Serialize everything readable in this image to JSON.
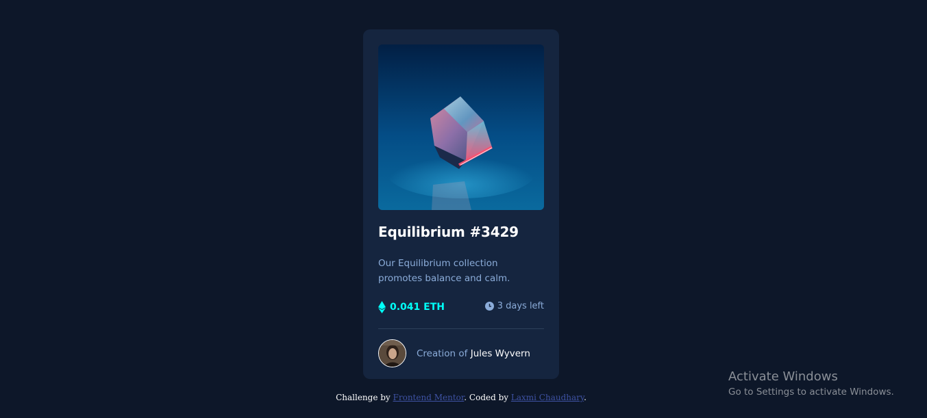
{
  "card": {
    "title": "Equilibrium #3429",
    "description": "Our Equilibrium collection promotes balance and calm.",
    "price": "0.041 ETH",
    "time_left": "3 days left",
    "creator_prefix": "Creation of ",
    "creator_name": "Jules Wyvern",
    "image_alt": "equilibrium-cube-image",
    "colors": {
      "background": "#0d1729",
      "card": "#15253f",
      "accent_cyan": "#00fff8",
      "soft_blue": "#8bacd9",
      "white": "#ffffff"
    }
  },
  "footer": {
    "prefix": "Challenge by ",
    "link1": "Frontend Mentor",
    "middle": ". Coded by ",
    "link2": "Laxmi Chaudhary",
    "suffix": "."
  },
  "watermark": {
    "title": "Activate Windows",
    "subtitle": "Go to Settings to activate Windows."
  },
  "icons": {
    "price": "ethereum-icon",
    "time": "clock-icon",
    "creator": "avatar"
  }
}
